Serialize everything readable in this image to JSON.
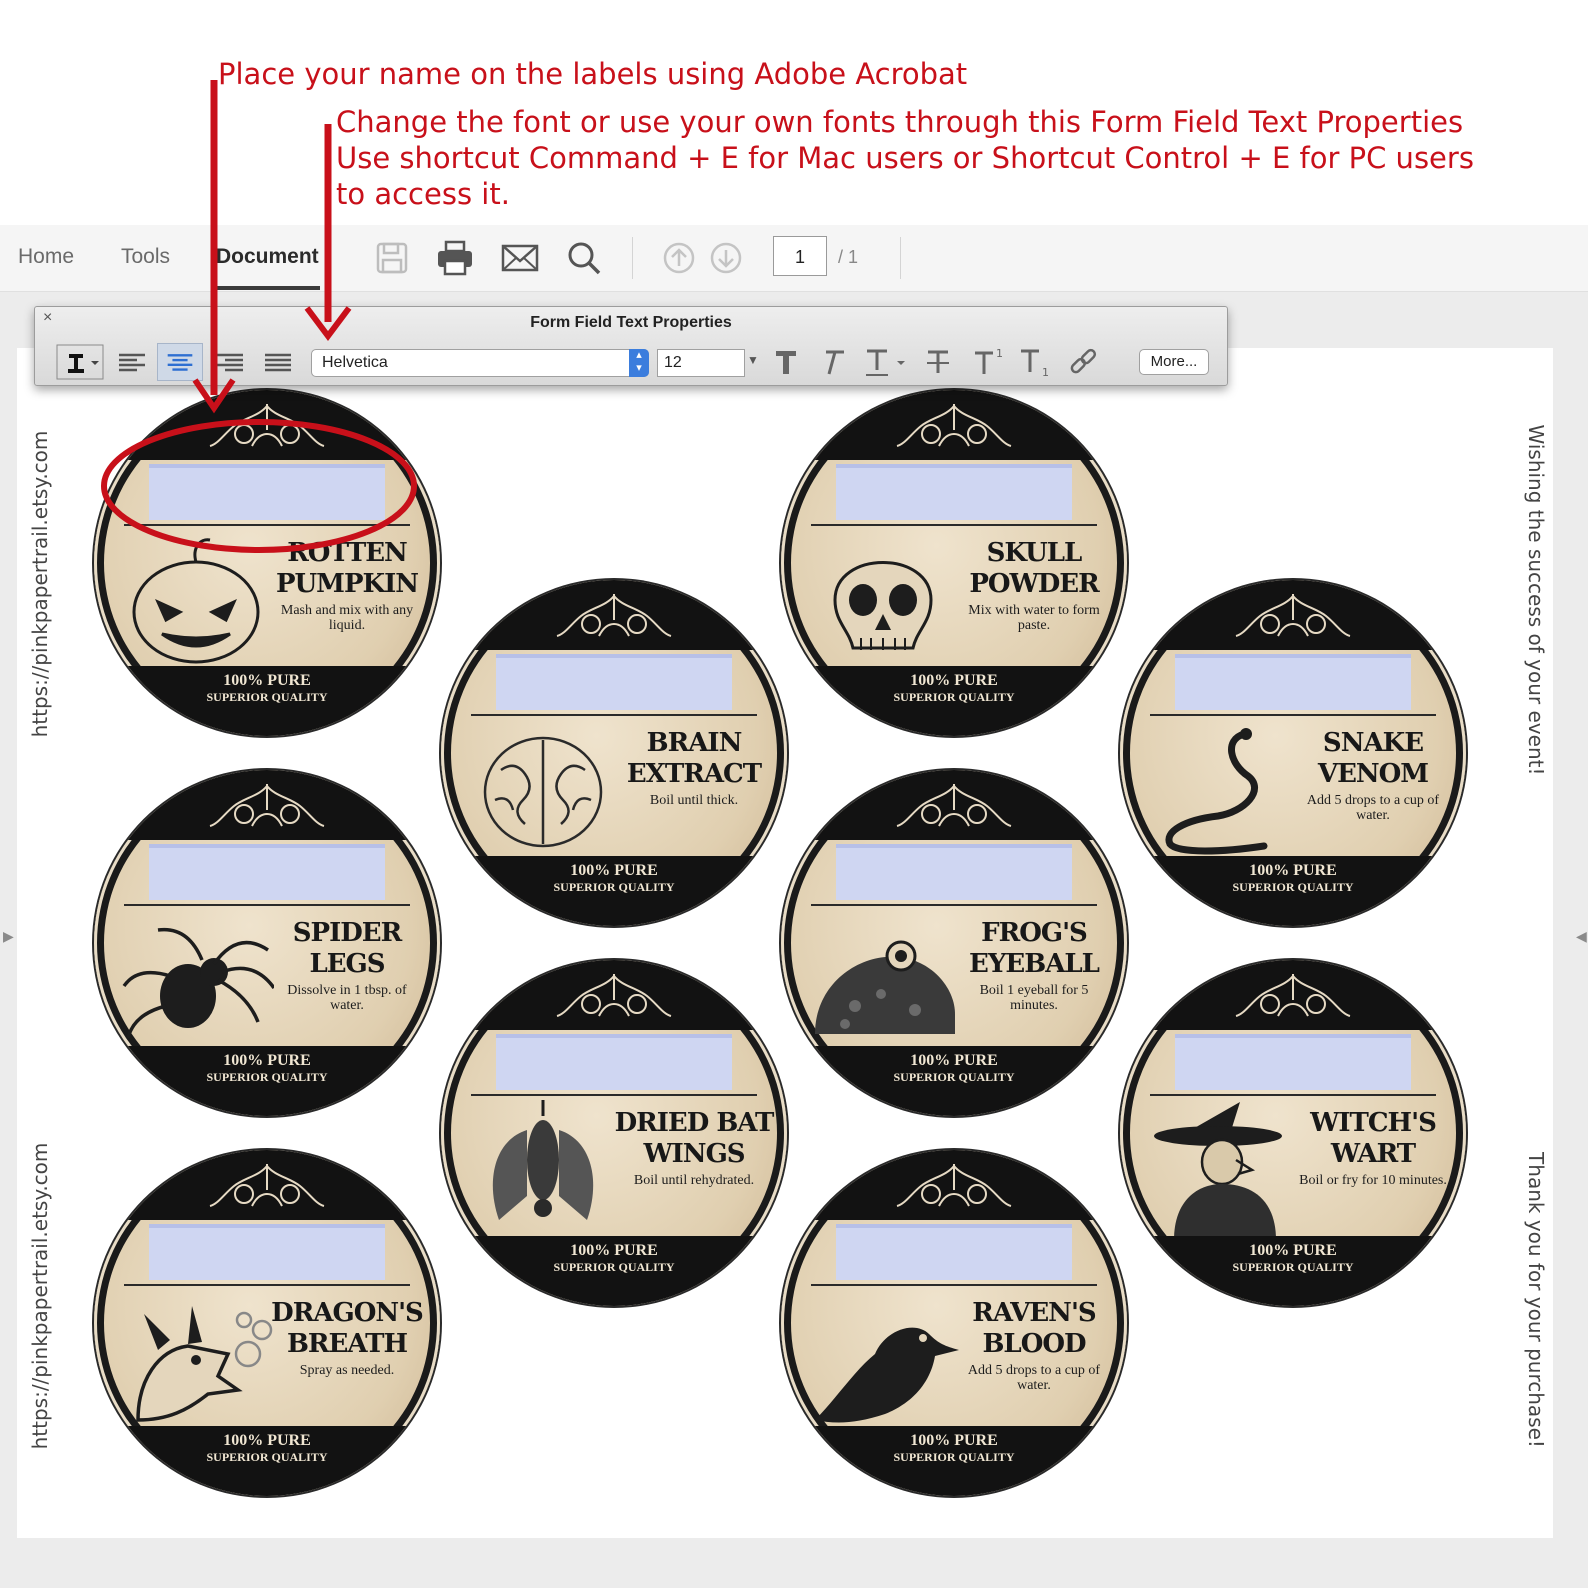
{
  "annotations": {
    "line1": "Place your name on the labels using Adobe Acrobat",
    "line2": "Change the font or use your own fonts through this Form Field Text Properties",
    "line3": "Use shortcut Command + E for Mac users or Shortcut Control + E for PC users",
    "line4": "to access it."
  },
  "toolbar": {
    "tabs": [
      "Home",
      "Tools",
      "Document"
    ],
    "active_tab": "Document",
    "page_current": "1",
    "page_total": "/ 1"
  },
  "panel": {
    "title": "Form Field Text Properties",
    "close": "×",
    "font": "Helvetica",
    "size": "12",
    "more_label": "More...",
    "selected_alignment": "center"
  },
  "page": {
    "left_text_top": "https://pinkpapertrail.etsy.com",
    "left_text_bottom": "https://pinkpapertrail.etsy.com",
    "right_text_top": "Wishing the success of your event!",
    "right_text_bottom": "Thank you for your purchase!"
  },
  "labels": [
    {
      "title": "ROTTEN PUMPKIN",
      "instruction": "Mash and mix with any liquid.",
      "pure": "100% PURE",
      "quality": "SUPERIOR QUALITY",
      "icon": "pumpkin-icon"
    },
    {
      "title": "BRAIN EXTRACT",
      "instruction": "Boil until thick.",
      "pure": "100% PURE",
      "quality": "SUPERIOR QUALITY",
      "icon": "brain-icon"
    },
    {
      "title": "SKULL POWDER",
      "instruction": "Mix with water to form paste.",
      "pure": "100% PURE",
      "quality": "SUPERIOR QUALITY",
      "icon": "skull-icon"
    },
    {
      "title": "SNAKE VENOM",
      "instruction": "Add 5 drops to a cup of water.",
      "pure": "100% PURE",
      "quality": "SUPERIOR QUALITY",
      "icon": "snake-icon"
    },
    {
      "title": "SPIDER LEGS",
      "instruction": "Dissolve in 1 tbsp. of water.",
      "pure": "100% PURE",
      "quality": "SUPERIOR QUALITY",
      "icon": "spider-icon"
    },
    {
      "title": "FROG'S EYEBALL",
      "instruction": "Boil 1 eyeball for 5 minutes.",
      "pure": "100% PURE",
      "quality": "SUPERIOR QUALITY",
      "icon": "frog-icon"
    },
    {
      "title": "DRIED BAT WINGS",
      "instruction": "Boil until rehydrated.",
      "pure": "100% PURE",
      "quality": "SUPERIOR QUALITY",
      "icon": "bat-icon"
    },
    {
      "title": "WITCH'S WART",
      "instruction": "Boil or fry for 10 minutes.",
      "pure": "100% PURE",
      "quality": "SUPERIOR QUALITY",
      "icon": "witch-icon"
    },
    {
      "title": "DRAGON'S BREATH",
      "instruction": "Spray as needed.",
      "pure": "100% PURE",
      "quality": "SUPERIOR QUALITY",
      "icon": "dragon-icon"
    },
    {
      "title": "RAVEN'S BLOOD",
      "instruction": "Add 5 drops to a cup of water.",
      "pure": "100% PURE",
      "quality": "SUPERIOR QUALITY",
      "icon": "raven-icon"
    }
  ],
  "colors": {
    "annotation_red": "#c8101a",
    "label_parchment": "#e6d6b8",
    "label_black": "#121212",
    "name_field_blue": "#cfd6f2",
    "selection_blue": "#3b7ddd"
  }
}
